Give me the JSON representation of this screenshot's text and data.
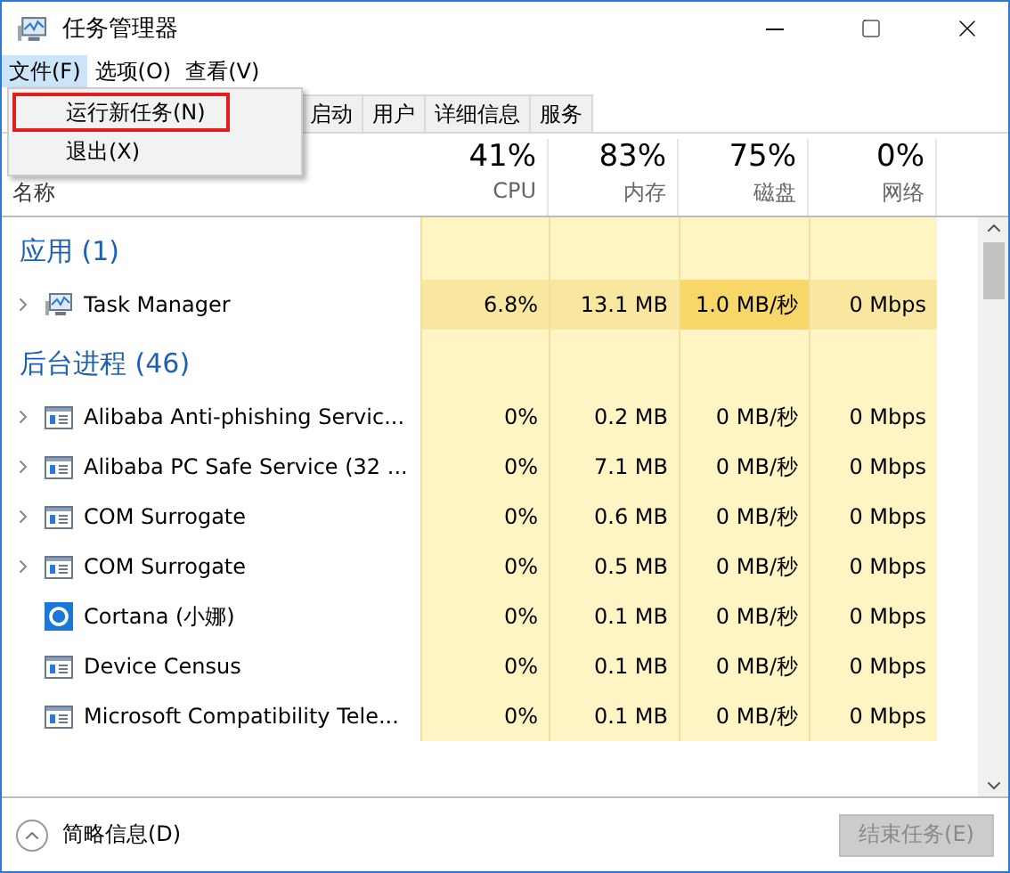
{
  "window": {
    "title": "任务管理器"
  },
  "menu_bar": [
    {
      "label": "文件(F)",
      "selected": true
    },
    {
      "label": "选项(O)",
      "selected": false
    },
    {
      "label": "查看(V)",
      "selected": false
    }
  ],
  "file_menu": [
    {
      "label": "运行新任务(N)",
      "highlighted": true
    },
    {
      "label": "退出(X)",
      "highlighted": false
    }
  ],
  "tabs": [
    {
      "label": "启动",
      "selected": false
    },
    {
      "label": "用户",
      "selected": false
    },
    {
      "label": "详细信息",
      "selected": false
    },
    {
      "label": "服务",
      "selected": false
    }
  ],
  "columns": [
    {
      "label": "名称"
    },
    {
      "total": "41%",
      "label": "CPU"
    },
    {
      "total": "83%",
      "label": "内存"
    },
    {
      "total": "75%",
      "label": "磁盘"
    },
    {
      "total": "0%",
      "label": "网络"
    }
  ],
  "groups": [
    {
      "title": "应用 (1)",
      "rows": [
        {
          "name": "Task Manager",
          "kind": "monitor",
          "expandable": true,
          "cells": [
            {
              "value": "6.8%",
              "kind": "medium"
            },
            {
              "value": "13.1 MB",
              "kind": "medium"
            },
            {
              "value": "1.0 MB/秒",
              "kind": "high"
            },
            {
              "value": "0 Mbps",
              "kind": "medium"
            }
          ]
        }
      ]
    },
    {
      "title": "后台进程 (46)",
      "rows": [
        {
          "name": "Alibaba Anti-phishing Servic...",
          "kind": "window",
          "expandable": true,
          "cells": [
            {
              "value": "0%",
              "kind": "low"
            },
            {
              "value": "0.2 MB",
              "kind": "low"
            },
            {
              "value": "0 MB/秒",
              "kind": "low"
            },
            {
              "value": "0 Mbps",
              "kind": "low"
            }
          ]
        },
        {
          "name": "Alibaba PC Safe Service (32 ...",
          "kind": "window",
          "expandable": true,
          "cells": [
            {
              "value": "0%",
              "kind": "low"
            },
            {
              "value": "7.1 MB",
              "kind": "low"
            },
            {
              "value": "0 MB/秒",
              "kind": "low"
            },
            {
              "value": "0 Mbps",
              "kind": "low"
            }
          ]
        },
        {
          "name": "COM Surrogate",
          "kind": "window",
          "expandable": true,
          "cells": [
            {
              "value": "0%",
              "kind": "low"
            },
            {
              "value": "0.6 MB",
              "kind": "low"
            },
            {
              "value": "0 MB/秒",
              "kind": "low"
            },
            {
              "value": "0 Mbps",
              "kind": "low"
            }
          ]
        },
        {
          "name": "COM Surrogate",
          "kind": "window",
          "expandable": true,
          "cells": [
            {
              "value": "0%",
              "kind": "low"
            },
            {
              "value": "0.5 MB",
              "kind": "low"
            },
            {
              "value": "0 MB/秒",
              "kind": "low"
            },
            {
              "value": "0 Mbps",
              "kind": "low"
            }
          ]
        },
        {
          "name": "Cortana (小娜)",
          "kind": "ring",
          "expandable": false,
          "cells": [
            {
              "value": "0%",
              "kind": "low"
            },
            {
              "value": "0.1 MB",
              "kind": "low"
            },
            {
              "value": "0 MB/秒",
              "kind": "low"
            },
            {
              "value": "0 Mbps",
              "kind": "low"
            }
          ]
        },
        {
          "name": "Device Census",
          "kind": "window",
          "expandable": false,
          "cells": [
            {
              "value": "0%",
              "kind": "low"
            },
            {
              "value": "0.1 MB",
              "kind": "low"
            },
            {
              "value": "0 MB/秒",
              "kind": "low"
            },
            {
              "value": "0 Mbps",
              "kind": "low"
            }
          ]
        },
        {
          "name": "Microsoft Compatibility Tele...",
          "kind": "window",
          "expandable": false,
          "cells": [
            {
              "value": "0%",
              "kind": "low"
            },
            {
              "value": "0.1 MB",
              "kind": "low"
            },
            {
              "value": "0 MB/秒",
              "kind": "low"
            },
            {
              "value": "0 Mbps",
              "kind": "low"
            }
          ]
        }
      ]
    }
  ],
  "footer": {
    "toggle": "简略信息(D)",
    "end_task": {
      "label": "结束任务(E)",
      "disabled": true
    }
  }
}
